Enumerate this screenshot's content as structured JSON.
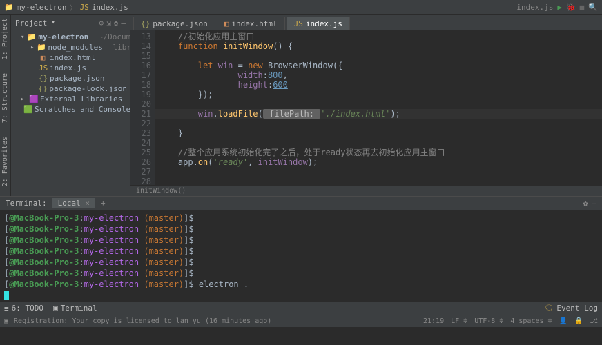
{
  "topbar": {
    "crumbs": [
      "my-electron",
      "index.js"
    ],
    "runTarget": "index.js"
  },
  "sidebar": {
    "title": "Project",
    "root": "my-electron",
    "rootPath": "~/Documents/cyri",
    "items": [
      {
        "label": "node_modules",
        "suffix": "library root",
        "kind": "folder"
      },
      {
        "label": "index.html",
        "kind": "html"
      },
      {
        "label": "index.js",
        "kind": "js"
      },
      {
        "label": "package.json",
        "kind": "json"
      },
      {
        "label": "package-lock.json",
        "kind": "json"
      }
    ],
    "extras": [
      "External Libraries",
      "Scratches and Consoles"
    ]
  },
  "vertTabs": [
    "1: Project",
    "7: Structure",
    "2: Favorites"
  ],
  "tabs": [
    {
      "label": "package.json",
      "kind": "json"
    },
    {
      "label": "index.html",
      "kind": "html"
    },
    {
      "label": "index.js",
      "kind": "js",
      "active": true
    }
  ],
  "code": {
    "startLine": 13,
    "currentLine": 21,
    "lines": [
      {
        "raw": "    //初始化应用主窗口"
      },
      {
        "raw": "    function initWindow() {"
      },
      {
        "raw": ""
      },
      {
        "raw": "        let win = new BrowserWindow({"
      },
      {
        "raw": "                width:800,"
      },
      {
        "raw": "                height:600"
      },
      {
        "raw": "        });"
      },
      {
        "raw": ""
      },
      {
        "raw": "        win.loadFile( filePath: './index.html');"
      },
      {
        "raw": ""
      },
      {
        "raw": "    }"
      },
      {
        "raw": ""
      },
      {
        "raw": "    //整个应用系统初始化完了之后，处于ready状态再去初始化应用主窗口"
      },
      {
        "raw": "    app.on('ready', initWindow);"
      },
      {
        "raw": ""
      },
      {
        "raw": ""
      }
    ],
    "breadcrumb": "initWindow()"
  },
  "terminalHeader": {
    "title": "Terminal:",
    "tab": "Local",
    "plus": "+"
  },
  "terminal": {
    "promptUser": "@MacBook-Pro-3",
    "promptDir": "my-electron",
    "promptBranch": "(master)",
    "promptSym": "$",
    "lines": [
      "",
      "",
      "",
      "",
      "",
      "",
      "electron ."
    ]
  },
  "bottombar": {
    "todo": "6: TODO",
    "terminal": "Terminal",
    "eventLog": "Event Log"
  },
  "status": {
    "msg": "Registration: Your copy is licensed to lan yu (16 minutes ago)",
    "pos": "21:19",
    "lf": "LF",
    "enc": "UTF-8",
    "indent": "4 spaces"
  }
}
